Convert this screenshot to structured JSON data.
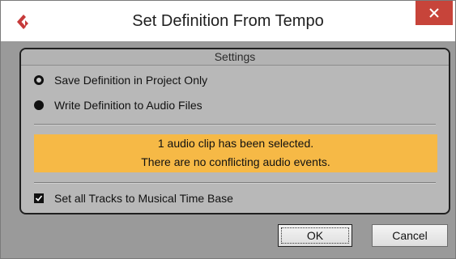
{
  "window": {
    "title": "Set Definition From Tempo",
    "app_icon": "cubase-logo-icon",
    "close_icon": "close-icon"
  },
  "settings": {
    "group_title": "Settings",
    "options": [
      {
        "label": "Save Definition in Project Only",
        "selected": false
      },
      {
        "label": "Write Definition to Audio Files",
        "selected": true
      }
    ],
    "info": {
      "line1": "1 audio clip has been selected.",
      "line2": "There are no conflicting audio events.",
      "color": "#f6b946"
    },
    "checkbox": {
      "label": "Set all Tracks to Musical Time Base",
      "checked": true
    }
  },
  "buttons": {
    "ok_label": "OK",
    "cancel_label": "Cancel"
  }
}
